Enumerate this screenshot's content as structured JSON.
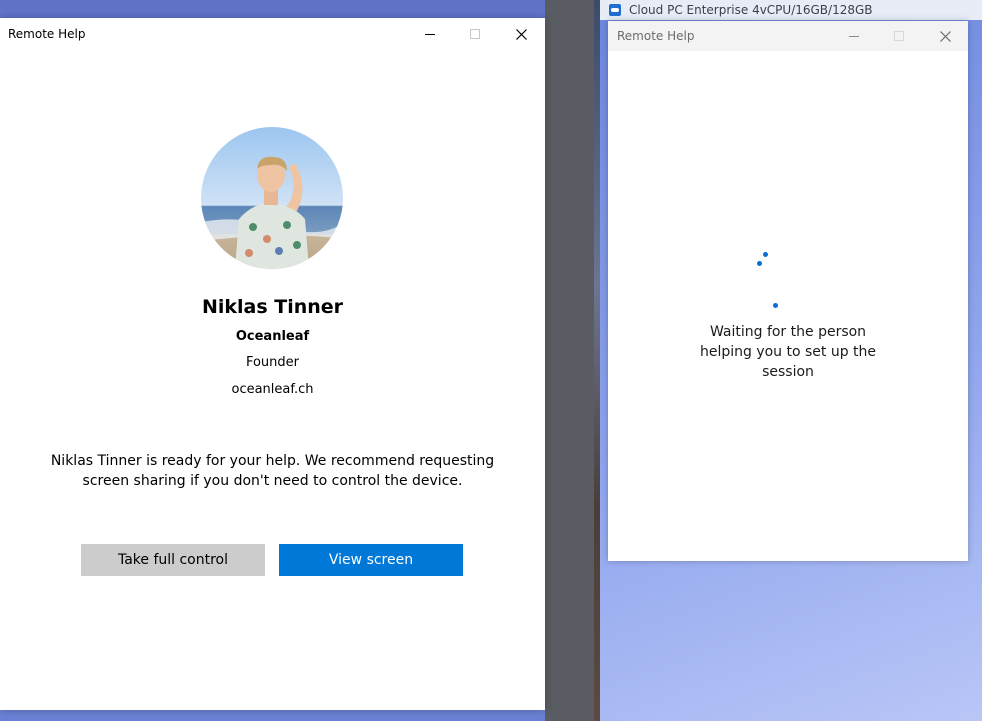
{
  "left_window": {
    "title": "Remote Help",
    "contact": {
      "name": "Niklas Tinner",
      "company": "Oceanleaf",
      "role": "Founder",
      "website": "oceanleaf.ch"
    },
    "message": "Niklas Tinner is ready for your help. We recommend requesting screen sharing if you don't need to control the device.",
    "buttons": {
      "full_control": "Take full control",
      "view_screen": "View screen"
    }
  },
  "cloud_pc": {
    "label": "Cloud PC Enterprise 4vCPU/16GB/128GB"
  },
  "right_window": {
    "title": "Remote Help",
    "status": "Waiting for the person helping you to set up the session"
  },
  "icons": {
    "minimize": "minimize-icon",
    "maximize": "maximize-icon",
    "close": "close-icon",
    "cloud_pc": "cloud-pc-icon",
    "spinner": "loading-spinner-icon"
  },
  "colors": {
    "primary_button": "#0078d7",
    "secondary_button": "#cccccc",
    "spinner": "#0a6fd3"
  }
}
